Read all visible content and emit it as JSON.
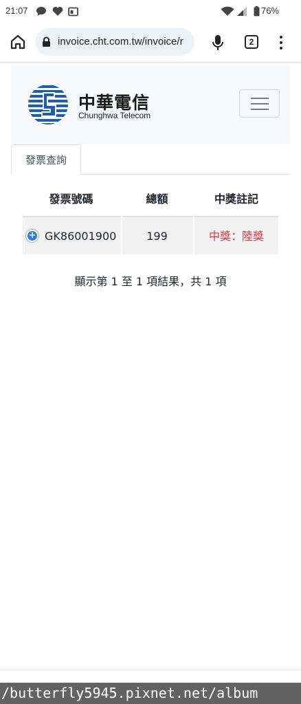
{
  "status_bar": {
    "time": "21:07",
    "battery": "76%",
    "icons": [
      "chat-bubble-icon",
      "heart-icon",
      "calendar-icon",
      "wifi-icon",
      "signal-icon",
      "battery-icon"
    ]
  },
  "browser": {
    "url": "invoice.cht.com.tw/invoice/r",
    "tab_count": "2",
    "icons": [
      "home-icon",
      "lock-icon",
      "mic-icon",
      "tabs-icon",
      "more-menu-icon"
    ]
  },
  "header": {
    "brand_zh": "中華電信",
    "brand_en": "Chunghwa Telecom",
    "brand_color": "#1f5fa6"
  },
  "tabs": [
    {
      "label": "發票查詢",
      "active": true
    }
  ],
  "table": {
    "columns": [
      "發票號碼",
      "總額",
      "中獎註記"
    ],
    "rows": [
      {
        "invoice_no": "GK86001900",
        "total": "199",
        "prize": "中獎：陸獎"
      }
    ],
    "prize_color": "#dc3545"
  },
  "table_info": "顯示第 1 至 1 項結果，共 1 項",
  "watermark": "/butterfly5945.pixnet.net/album"
}
